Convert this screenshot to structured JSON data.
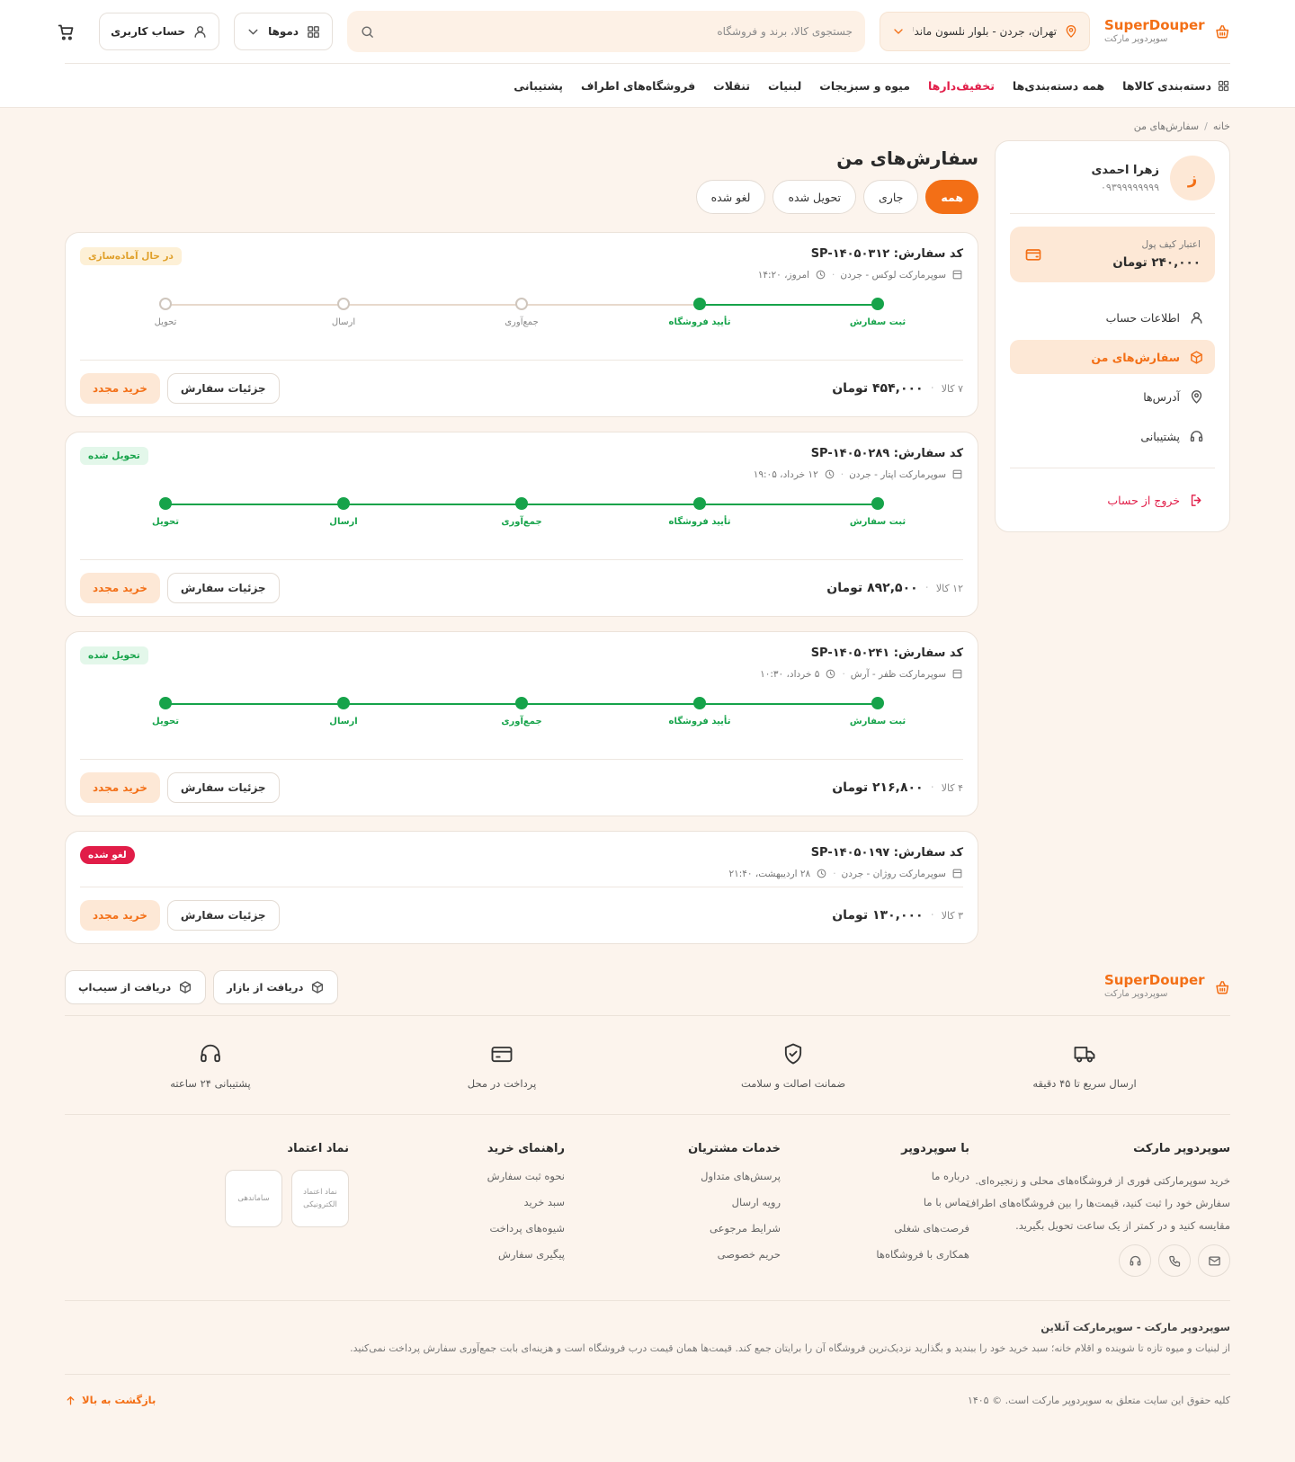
{
  "header": {
    "logo_en": "SuperDouper",
    "logo_fa": "سوپردوپر مارکت",
    "location": "تهران، جردن - بلوار نلسون ماندلا",
    "search_placeholder": "جستجوی کالا، برند و فروشگاه",
    "demos_label": "دموها",
    "account_label": "حساب کاربری",
    "icons": {
      "logo": "shopping-basket-icon",
      "location": "map-pin-icon",
      "search": "search-icon",
      "demos": "grid-icon",
      "account": "user-icon",
      "cart": "cart-icon"
    }
  },
  "nav": {
    "categories": "دسته‌بندی کالاها",
    "items": [
      {
        "label": "همه دسته‌بندی‌ها",
        "accent": false
      },
      {
        "label": "تخفیف‌دارها",
        "accent": true
      },
      {
        "label": "میوه و سبزیجات",
        "accent": false
      },
      {
        "label": "لبنیات",
        "accent": false
      },
      {
        "label": "تنقلات",
        "accent": false
      },
      {
        "label": "فروشگاه‌های اطراف",
        "accent": false
      },
      {
        "label": "پشتیبانی",
        "accent": false
      }
    ]
  },
  "breadcrumb": {
    "home": "خانه",
    "sep": "/",
    "current": "سفارش‌های من"
  },
  "sidebar": {
    "avatar_letter": "ز",
    "name": "زهرا احمدی",
    "phone": "۰۹۳۹۹۹۹۹۹۹۹",
    "wallet_label": "اعتبار کیف پول",
    "wallet_amount": "۲۴۰,۰۰۰ تومان",
    "menu": [
      {
        "label": "اطلاعات حساب",
        "icon": "user-icon"
      },
      {
        "label": "سفارش‌های من",
        "icon": "box-icon",
        "active": true
      },
      {
        "label": "آدرس‌ها",
        "icon": "map-pin-icon"
      },
      {
        "label": "پشتیبانی",
        "icon": "headset-icon"
      }
    ],
    "logout": "خروج از حساب"
  },
  "page": {
    "title": "سفارش‌های من",
    "tabs": [
      {
        "label": "همه",
        "active": true
      },
      {
        "label": "جاری",
        "active": false
      },
      {
        "label": "تحویل شده",
        "active": false
      },
      {
        "label": "لغو شده",
        "active": false
      }
    ]
  },
  "steps": [
    "ثبت سفارش",
    "تأیید فروشگاه",
    "جمع‌آوری",
    "ارسال",
    "تحویل"
  ],
  "orders": [
    {
      "code": "کد سفارش: SP-۱۴۰۵۰۳۱۲",
      "store": "سوپرمارکت لوکس - جردن",
      "time": "امروز، ۱۴:۲۰",
      "status": "در حال آماده‌سازی",
      "status_type": "processing",
      "progress": 2,
      "count": "۷ کالا",
      "total": "۴۵۴,۰۰۰ تومان"
    },
    {
      "code": "کد سفارش: SP-۱۴۰۵۰۲۸۹",
      "store": "سوپرمارکت اپتار - جردن",
      "time": "۱۲ خرداد، ۱۹:۰۵",
      "status": "تحویل شده",
      "status_type": "delivered",
      "progress": 5,
      "count": "۱۲ کالا",
      "total": "۸۹۲,۵۰۰ تومان"
    },
    {
      "code": "کد سفارش: SP-۱۴۰۵۰۲۴۱",
      "store": "سوپرمارکت ظفر - آرش",
      "time": "۵ خرداد، ۱۰:۳۰",
      "status": "تحویل شده",
      "status_type": "delivered",
      "progress": 5,
      "count": "۴ کالا",
      "total": "۲۱۶,۸۰۰ تومان"
    },
    {
      "code": "کد سفارش: SP-۱۴۰۵۰۱۹۷",
      "store": "سوپرمارکت روژان - جردن",
      "time": "۲۸ اردیبهشت، ۲۱:۴۰",
      "status": "لغو شده",
      "status_type": "canceled",
      "progress": 0,
      "count": "۳ کالا",
      "total": "۱۳۰,۰۰۰ تومان"
    }
  ],
  "order_actions": {
    "details": "جزئیات سفارش",
    "reorder": "خرید مجدد"
  },
  "footer": {
    "app_bazaar": "دریافت از بازار",
    "app_sibapp": "دریافت از سیب‌اپ",
    "features": [
      {
        "label": "ارسال سریع تا ۴۵ دقیقه",
        "icon": "truck-icon"
      },
      {
        "label": "ضمانت اصالت و سلامت",
        "icon": "shield-check-icon"
      },
      {
        "label": "پرداخت در محل",
        "icon": "card-icon"
      },
      {
        "label": "پشتیبانی ۲۴ ساعته",
        "icon": "headset-icon"
      }
    ],
    "about_title": "سوپردوپر مارکت",
    "about_text": "خرید سوپرمارکتی فوری از فروشگاه‌های محلی و زنجیره‌ای. سفارش خود را ثبت کنید، قیمت‌ها را بین فروشگاه‌های اطراف مقایسه کنید و در کمتر از یک ساعت تحویل بگیرید.",
    "cols": [
      {
        "title": "با سوپردوپر",
        "links": [
          "درباره ما",
          "تماس با ما",
          "فرصت‌های شغلی",
          "همکاری با فروشگاه‌ها"
        ]
      },
      {
        "title": "خدمات مشتریان",
        "links": [
          "پرسش‌های متداول",
          "رویه ارسال",
          "شرایط مرجوعی",
          "حریم خصوصی"
        ]
      },
      {
        "title": "راهنمای خرید",
        "links": [
          "نحوه ثبت سفارش",
          "سبد خرید",
          "شیوه‌های پرداخت",
          "پیگیری سفارش"
        ]
      }
    ],
    "trust_title": "نماد اعتماد",
    "trust_1": "نماد اعتماد الکترونیکی",
    "trust_2": "ساماندهی",
    "desc_title": "سوپردوپر مارکت - سوپرمارکت آنلاین",
    "desc_text": "از لبنیات و میوه تازه تا شوینده و اقلام خانه؛ سبد خرید خود را ببندید و بگذارید نزدیک‌ترین فروشگاه آن را برایتان جمع کند. قیمت‌ها همان قیمت درب فروشگاه است و هزینه‌ای بابت جمع‌آوری سفارش پرداخت نمی‌کنید.",
    "copyright": "کلیه حقوق این سایت متعلق به سوپردوپر مارکت است. © ۱۴۰۵",
    "back_top": "بازگشت به بالا"
  },
  "colors": {
    "brand": "#f36f16",
    "danger": "#e11d48",
    "success": "#16a34a",
    "background": "#fcf4ed"
  }
}
